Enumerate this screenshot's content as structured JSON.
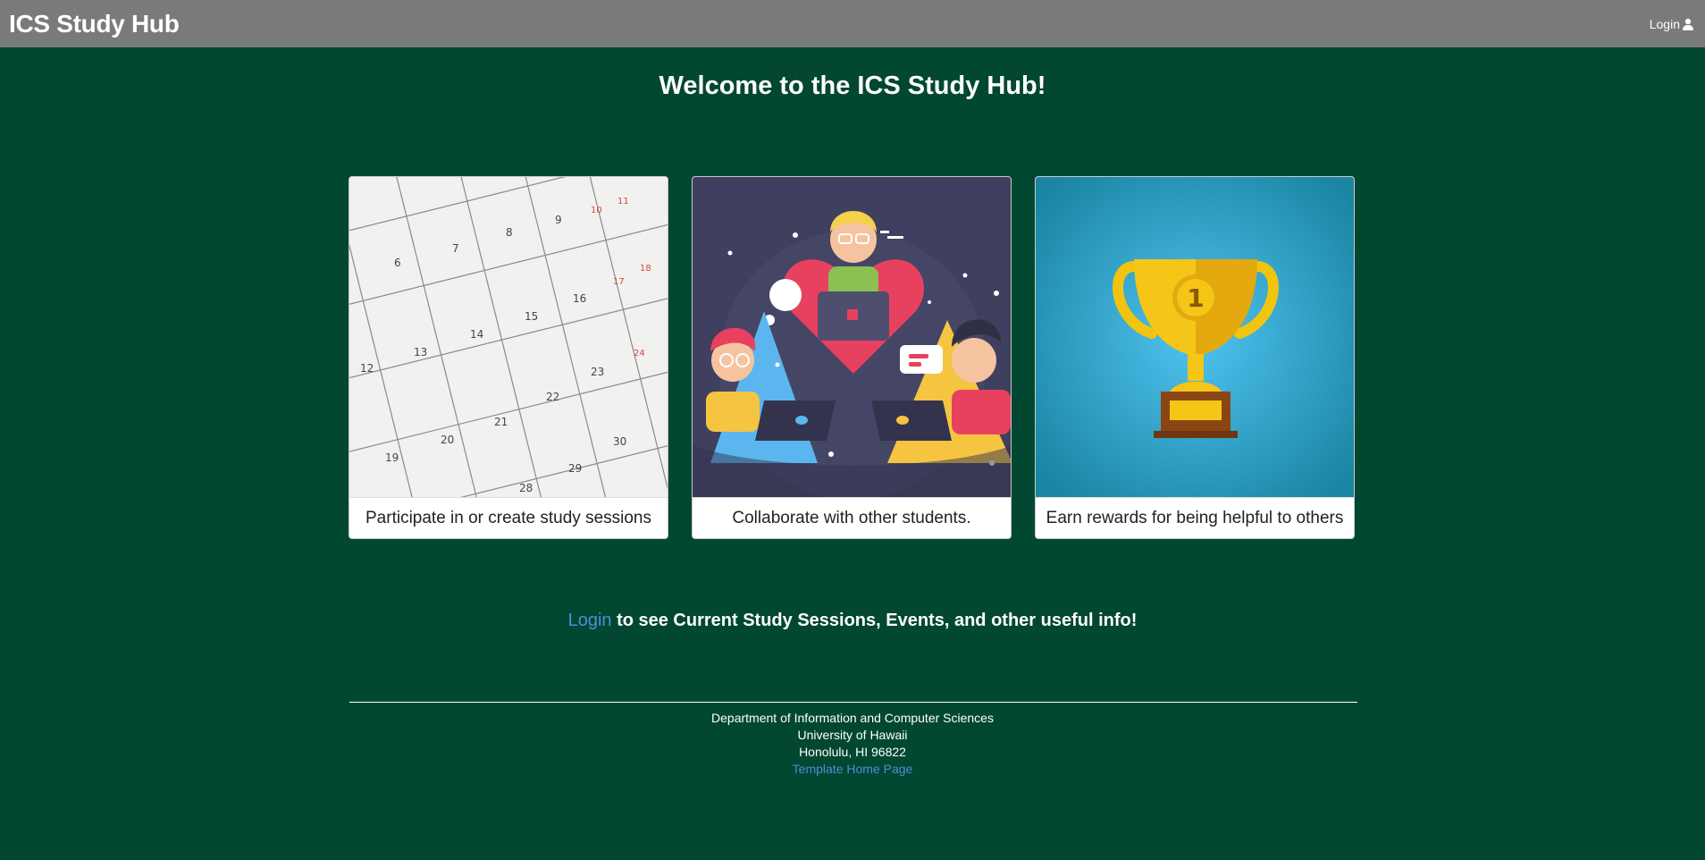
{
  "navbar": {
    "brand": "ICS Study Hub",
    "login_label": "Login",
    "login_icon": "user-icon"
  },
  "main": {
    "heading": "Welcome to the ICS Study Hub!",
    "cards": [
      {
        "caption": "Participate in or create study sessions",
        "image": "calendar-image"
      },
      {
        "caption": "Collaborate with other students.",
        "image": "students-collaborating-image"
      },
      {
        "caption": "Earn rewards for being helpful to others",
        "image": "trophy-image"
      }
    ],
    "login_prompt": {
      "link_text": "Login",
      "rest_text": " to see Current Study Sessions, Events, and other useful info!"
    }
  },
  "footer": {
    "line1": "Department of Information and Computer Sciences",
    "line2": "University of Hawaii",
    "line3": "Honolulu, HI 96822",
    "link": "Template Home Page"
  },
  "colors": {
    "background": "#024731",
    "navbar": "#7a7a7a",
    "link": "#4a8fd6"
  }
}
